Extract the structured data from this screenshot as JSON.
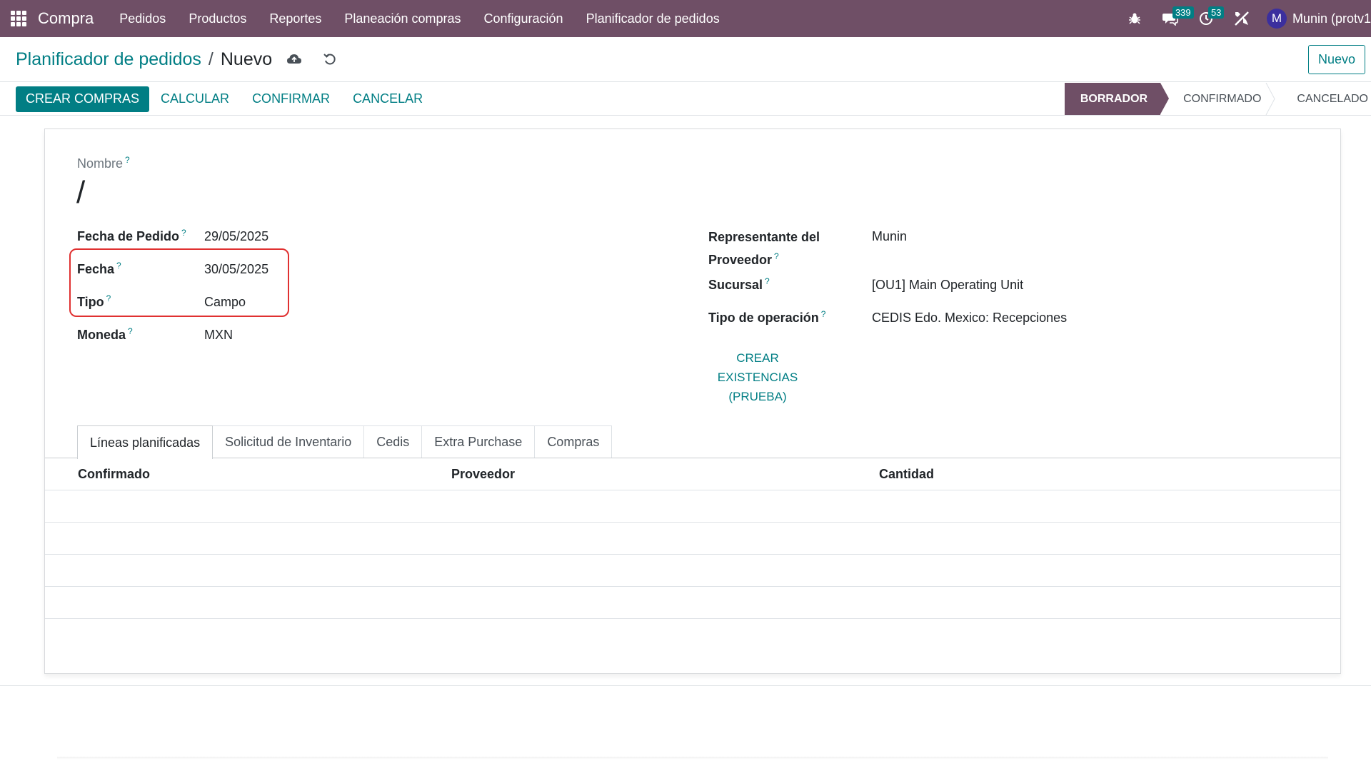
{
  "topbar": {
    "app_name": "Compra",
    "menu": [
      "Pedidos",
      "Productos",
      "Reportes",
      "Planeación compras",
      "Configuración",
      "Planificador de pedidos"
    ],
    "messages_count": "339",
    "activities_count": "53",
    "avatar_letter": "M",
    "user_name": "Munin (protv1"
  },
  "breadcrumb": {
    "parent": "Planificador de pedidos",
    "separator": "/",
    "current": "Nuevo"
  },
  "new_button": "Nuevo",
  "actions": {
    "create_purchases": "CREAR COMPRAS",
    "calculate": "CALCULAR",
    "confirm": "CONFIRMAR",
    "cancel": "CANCELAR"
  },
  "status": {
    "stages": [
      "BORRADOR",
      "CONFIRMADO",
      "CANCELADO"
    ],
    "active": "BORRADOR"
  },
  "form": {
    "name_label": "Nombre",
    "name_value": "/",
    "help_mark": "?",
    "order_date_label": "Fecha de Pedido",
    "order_date_value": "29/05/2025",
    "date_label": "Fecha",
    "date_value": "30/05/2025",
    "type_label": "Tipo",
    "type_value": "Campo",
    "currency_label": "Moneda",
    "currency_value": "MXN",
    "vendor_rep_label_1": "Representante del",
    "vendor_rep_label_2": "Proveedor",
    "vendor_rep_value": "Munin",
    "branch_label": "Sucursal",
    "branch_value": "[OU1] Main Operating Unit",
    "op_type_label": "Tipo de operación",
    "op_type_value": "CEDIS Edo. Mexico: Recepciones",
    "smart_button_lines": [
      "CREAR",
      "EXISTENCIAS",
      "(PRUEBA)"
    ]
  },
  "tabs": [
    "Líneas planificadas",
    "Solicitud de Inventario",
    "Cedis",
    "Extra Purchase",
    "Compras"
  ],
  "table": {
    "columns": [
      "Confirmado",
      "Proveedor",
      "Cantidad"
    ]
  },
  "colors": {
    "navbar": "#6f4f66",
    "accent": "#017e84",
    "highlight": "#e03131"
  }
}
